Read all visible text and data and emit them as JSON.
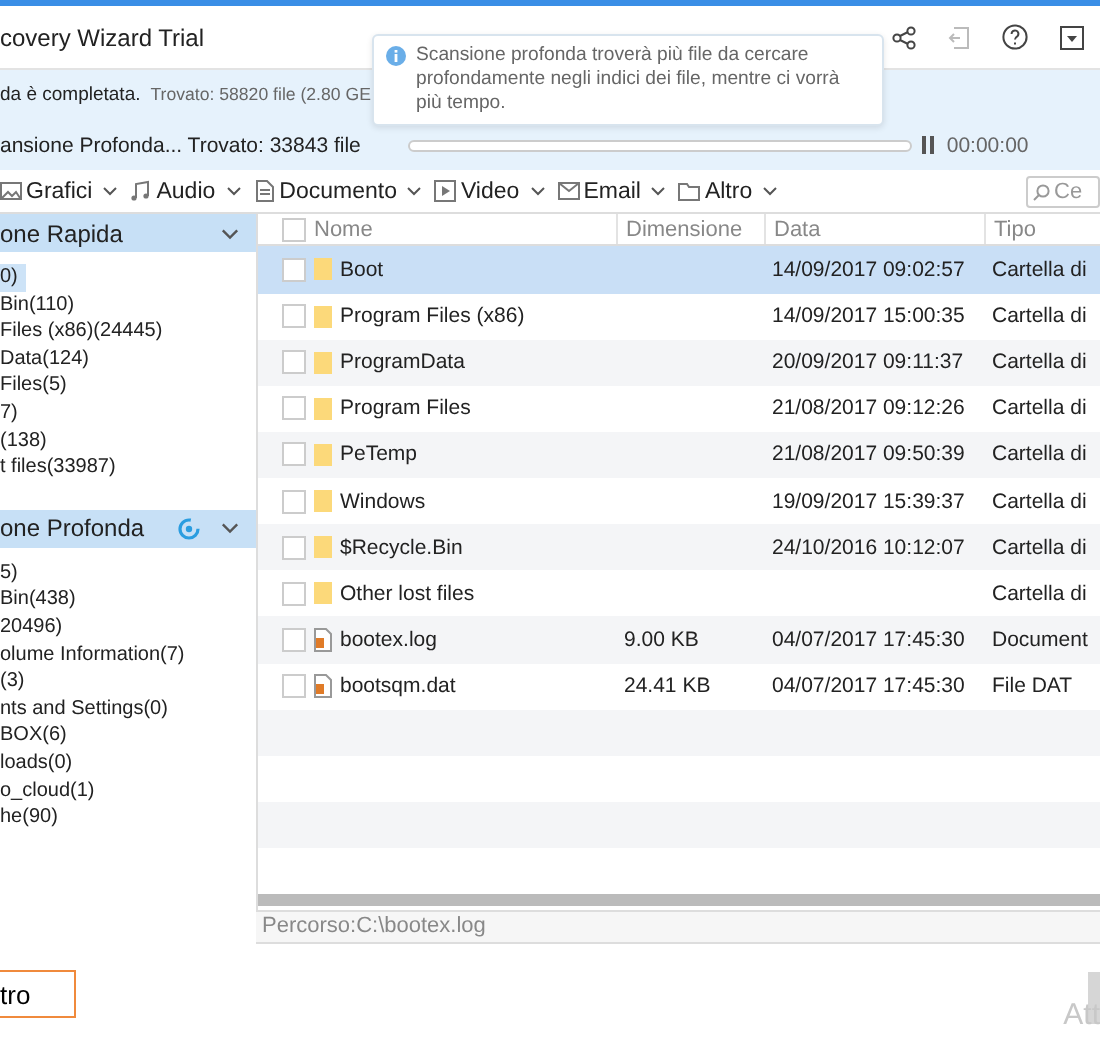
{
  "window": {
    "title": "covery Wizard Trial"
  },
  "status": {
    "completed": "da è completata.",
    "found": "Trovato: 58820 file (2.80 GE",
    "scanning": "ansione Profonda... Trovato: 33843 file",
    "level": 0.0,
    "elapsed": "00:00:00"
  },
  "tooltip": {
    "text": "Scansione profonda troverà più file da cercare profondamente negli indici dei file, mentre ci vorrà più tempo."
  },
  "filters": [
    "Grafici",
    "Audio",
    "Documento",
    "Video",
    "Email",
    "Altro"
  ],
  "search": {
    "placeholder": "Ce"
  },
  "sidebar": [
    {
      "title": "one Rapida",
      "kind": "quick",
      "items": [
        {
          "label": "0)",
          "selected": true
        },
        {
          "label": "Bin(110)",
          "selected": false
        },
        {
          "label": "Files (x86)(24445)",
          "selected": false
        },
        {
          "label": "Data(124)",
          "selected": false
        },
        {
          "label": "Files(5)",
          "selected": false
        },
        {
          "label": "7)",
          "selected": false
        },
        {
          "label": "(138)",
          "selected": false
        },
        {
          "label": "t files(33987)",
          "selected": false
        }
      ]
    },
    {
      "title": "one Profonda",
      "kind": "deep",
      "items": [
        {
          "label": "5)",
          "selected": false
        },
        {
          "label": "Bin(438)",
          "selected": false
        },
        {
          "label": "20496)",
          "selected": false
        },
        {
          "label": "olume Information(7)",
          "selected": false
        },
        {
          "label": "(3)",
          "selected": false
        },
        {
          "label": "nts and Settings(0)",
          "selected": false
        },
        {
          "label": "BOX(6)",
          "selected": false
        },
        {
          "label": "loads(0)",
          "selected": false
        },
        {
          "label": "o_cloud(1)",
          "selected": false
        },
        {
          "label": "he(90)",
          "selected": false
        }
      ]
    }
  ],
  "table": {
    "columns": [
      "Nome",
      "Dimensione",
      "Data",
      "Tipo"
    ],
    "rows": [
      {
        "kind": "folder",
        "name": "Boot",
        "date": "14/09/2017 09:02:57",
        "type": "Cartella di",
        "selected": true,
        "checked": false
      },
      {
        "kind": "folder",
        "name": "Program Files (x86)",
        "date": "14/09/2017 15:00:35",
        "type": "Cartella di",
        "selected": false,
        "checked": false
      },
      {
        "kind": "folder",
        "name": "ProgramData",
        "date": "20/09/2017 09:11:37",
        "type": "Cartella di",
        "selected": false,
        "checked": false
      },
      {
        "kind": "folder",
        "name": "Program Files",
        "date": "21/08/2017 09:12:26",
        "type": "Cartella di",
        "selected": false,
        "checked": false
      },
      {
        "kind": "folder",
        "name": "PeTemp",
        "date": "21/08/2017 09:50:39",
        "type": "Cartella di",
        "selected": false,
        "checked": false
      },
      {
        "kind": "folder",
        "name": "Windows",
        "date": "19/09/2017 15:39:37",
        "type": "Cartella di",
        "selected": false,
        "checked": false
      },
      {
        "kind": "folder",
        "name": "$Recycle.Bin",
        "date": "24/10/2016 10:12:07",
        "type": "Cartella di",
        "selected": false,
        "checked": false
      },
      {
        "kind": "folder",
        "name": "Other lost files",
        "type": "Cartella di",
        "selected": false,
        "checked": false
      },
      {
        "kind": "file",
        "name": "bootex.log",
        "size": "9.00 KB",
        "date": "04/07/2017 17:45:30",
        "type": "Document",
        "selected": false,
        "checked": false
      },
      {
        "kind": "file",
        "name": "bootsqm.dat",
        "size": "24.41 KB",
        "date": "04/07/2017 17:45:30",
        "type": "File DAT",
        "selected": false,
        "checked": false
      }
    ]
  },
  "path_bar": "Percorso:C:\\bootex.log",
  "footer": {
    "button": "tro",
    "watermark": "Att"
  }
}
